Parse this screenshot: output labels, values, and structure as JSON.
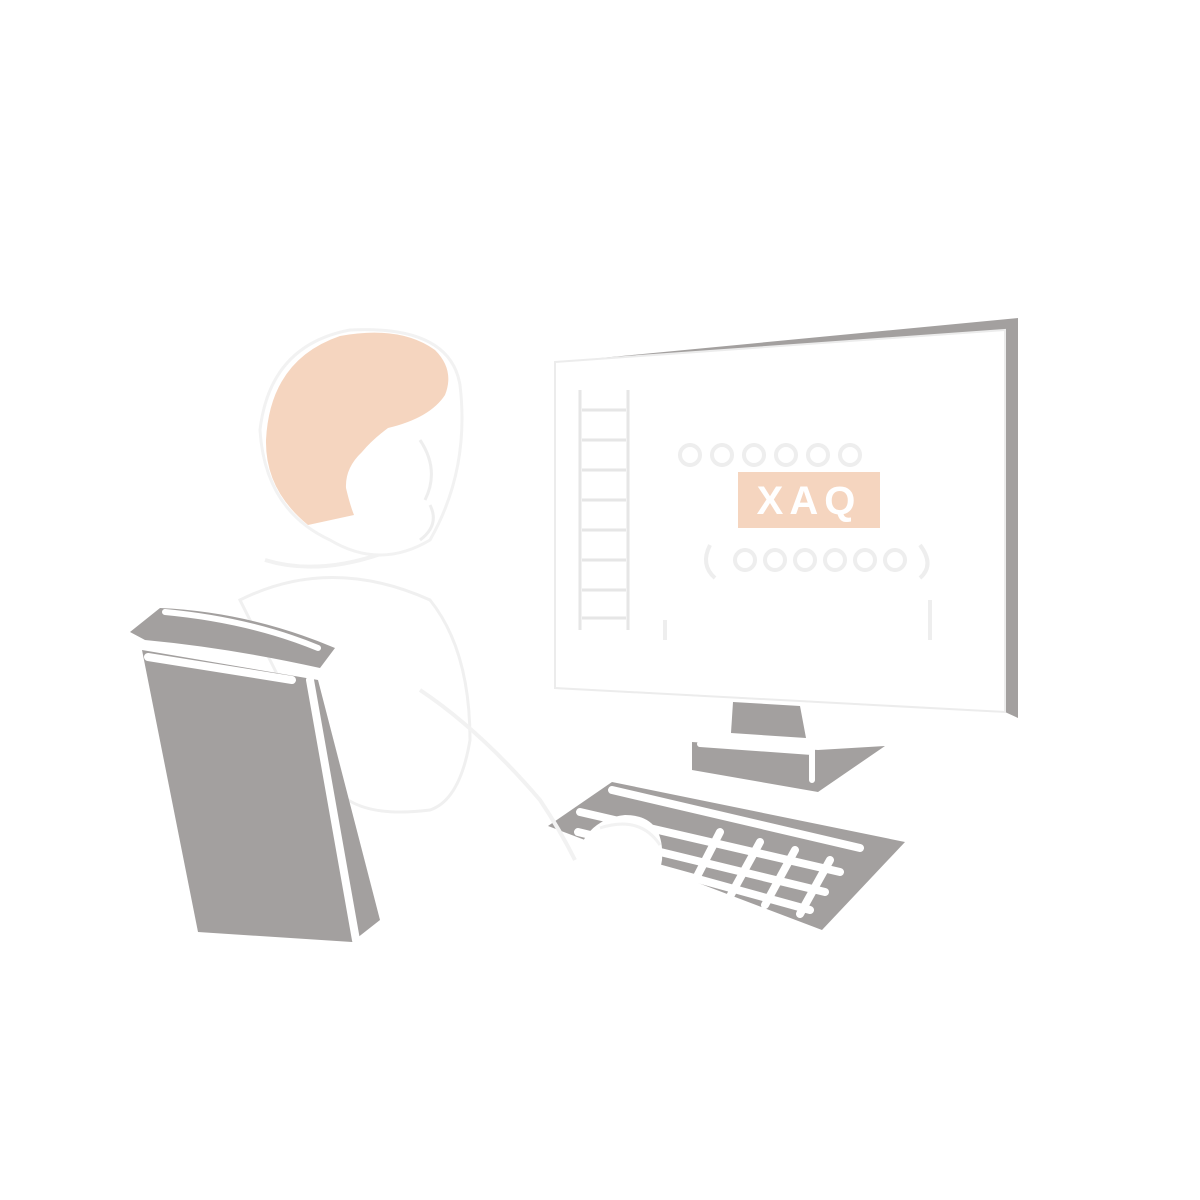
{
  "scene": {
    "background_color": "#ffffff",
    "colors": {
      "grey": "#a3a09f",
      "skin": "#f5d5bf",
      "white": "#ffffff",
      "line": "#e6e6e6"
    }
  },
  "screen": {
    "highlight_text": "XAQ",
    "highlight_color": "#f5d5bf"
  },
  "icons": {
    "person": "person-icon",
    "chair": "chair-icon",
    "monitor": "monitor-icon",
    "keyboard": "keyboard-icon"
  }
}
